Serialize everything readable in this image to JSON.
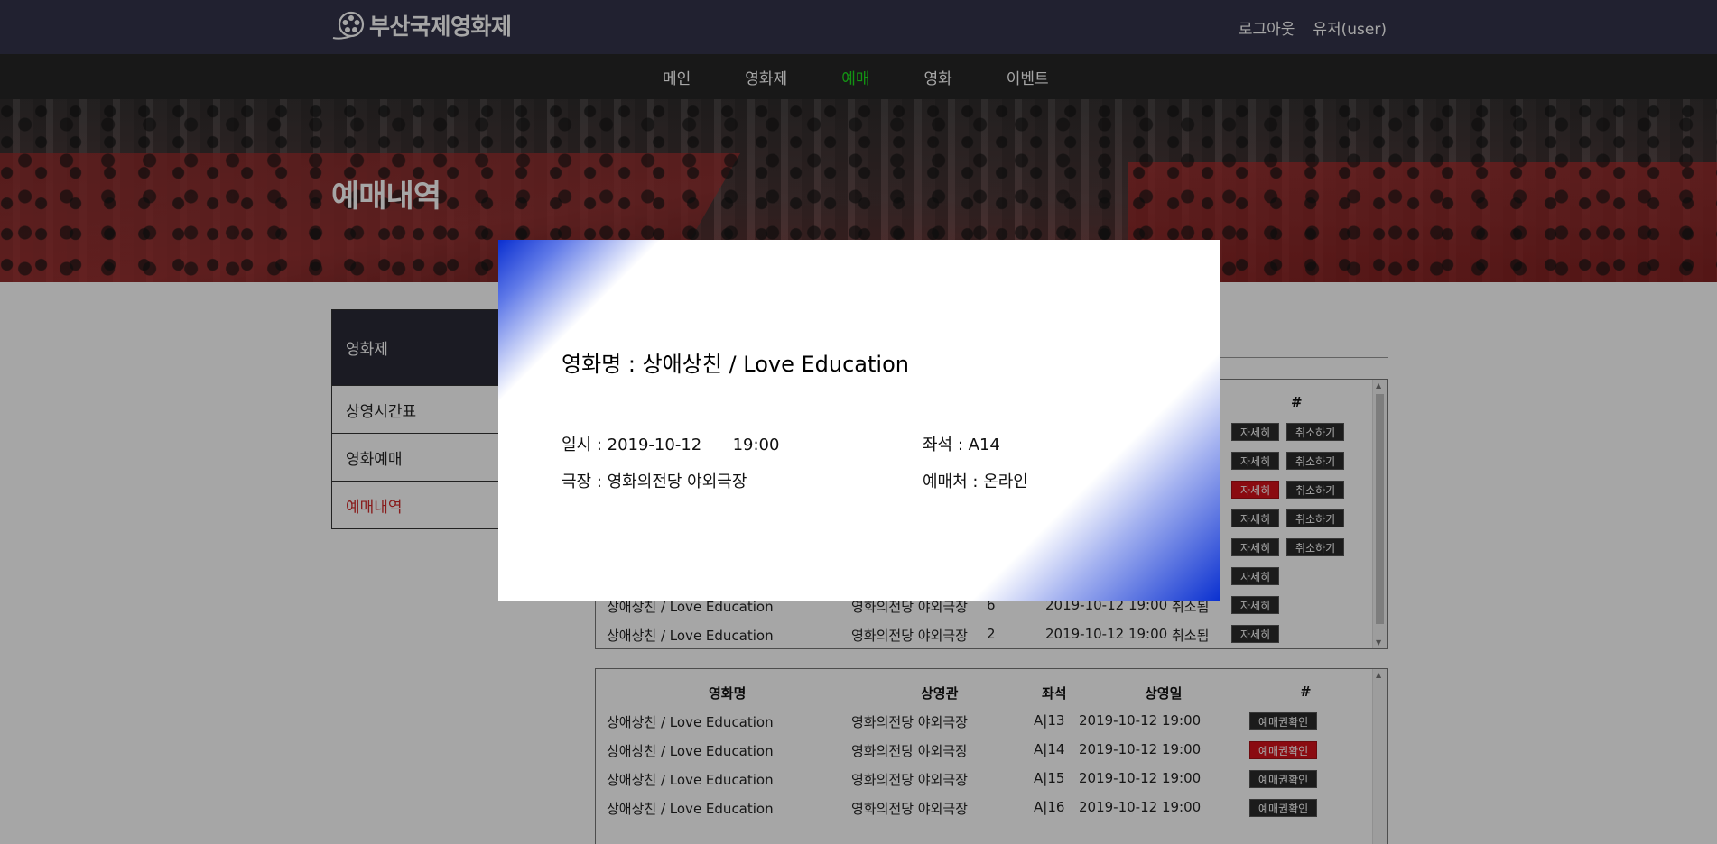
{
  "header": {
    "logo_text": "부산국제영화제",
    "logout": "로그아웃",
    "user": "유저(user)"
  },
  "nav": {
    "items": [
      "메인",
      "영화제",
      "예매",
      "영화",
      "이벤트"
    ],
    "active_index": 2,
    "active_color": "#1ee31e"
  },
  "hero": {
    "title": "예매내역"
  },
  "sidebar": {
    "heading": "영화제",
    "items": [
      "상영시간표",
      "영화예매",
      "예매내역"
    ],
    "active_index": 2
  },
  "reservations": {
    "header_hash": "#",
    "rows": [
      {
        "movie": "상애상친 / Love Education",
        "theater": "영화의전당 야외극장",
        "seat": "6",
        "datetime": "2019-10-12 19:00",
        "status": "취소됨",
        "detail": "자세히"
      },
      {
        "movie": "상애상친 / Love Education",
        "theater": "영화의전당 야외극장",
        "seat": "2",
        "datetime": "2019-10-12 19:00",
        "status": "취소됨",
        "detail": "자세히"
      }
    ],
    "buttons": {
      "detail": "자세히",
      "cancel": "취소하기"
    }
  },
  "tickets": {
    "headers": {
      "movie": "영화명",
      "theater": "상영관",
      "seat": "좌석",
      "date": "상영일",
      "hash": "#"
    },
    "rows": [
      {
        "movie": "상애상친 / Love Education",
        "theater": "영화의전당 야외극장",
        "seat": "A|13",
        "datetime": "2019-10-12 19:00",
        "button": "예매권확인"
      },
      {
        "movie": "상애상친 / Love Education",
        "theater": "영화의전당 야외극장",
        "seat": "A|14",
        "datetime": "2019-10-12 19:00",
        "button": "예매권확인"
      },
      {
        "movie": "상애상친 / Love Education",
        "theater": "영화의전당 야외극장",
        "seat": "A|15",
        "datetime": "2019-10-12 19:00",
        "button": "예매권확인"
      },
      {
        "movie": "상애상친 / Love Education",
        "theater": "영화의전당 야외극장",
        "seat": "A|16",
        "datetime": "2019-10-12 19:00",
        "button": "예매권확인"
      }
    ]
  },
  "modal": {
    "title": "영화명 : 상애상친 / Love Education",
    "date": "일시 : 2019-10-12      19:00",
    "seat": "좌석 : A14",
    "theater": "극장 : 영화의전당 야외극장",
    "source": "예매처 : 온라인",
    "gradient_color": "#0a2fd0"
  }
}
